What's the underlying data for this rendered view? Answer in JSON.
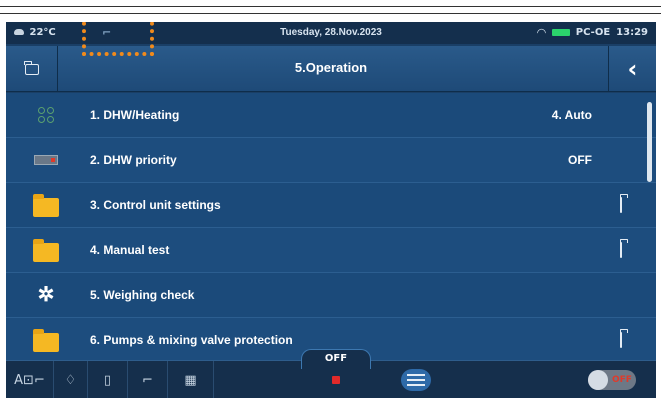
{
  "status_bar": {
    "temperature": "22°C",
    "date": "Tuesday, 28.Nov.2023",
    "device_name": "PC-OE",
    "time": "13:29"
  },
  "title_bar": {
    "title": "5.Operation"
  },
  "menu": {
    "items": [
      {
        "label": "1. DHW/Heating",
        "value": "4. Auto",
        "icon": "mode-dots-icon"
      },
      {
        "label": "2. DHW priority",
        "value": "OFF",
        "icon": "boiler-icon"
      },
      {
        "label": "3. Control unit settings",
        "value": "",
        "icon": "folder-icon"
      },
      {
        "label": "4. Manual test",
        "value": "",
        "icon": "folder-icon"
      },
      {
        "label": "5. Weighing check",
        "value": "",
        "icon": "gear-icon"
      },
      {
        "label": "6. Pumps & mixing valve protection",
        "value": "",
        "icon": "folder-icon"
      }
    ]
  },
  "bottom_bar": {
    "off_label": "OFF",
    "toggle_label": "OFF"
  },
  "colors": {
    "highlight": "#f08a1c",
    "background": "#1b4a7a",
    "folder": "#f5b823"
  }
}
